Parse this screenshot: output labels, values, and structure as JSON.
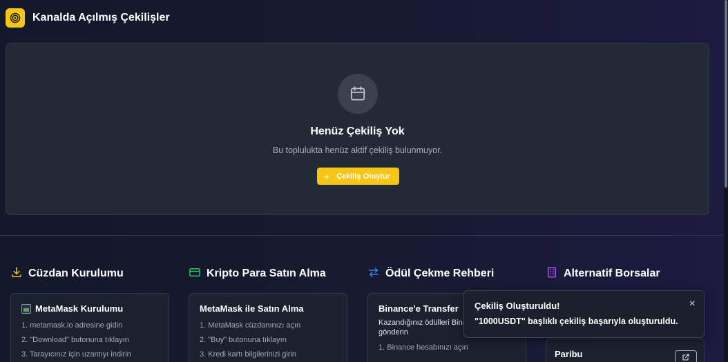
{
  "header": {
    "title": "Kanalda Açılmış Çekilişler",
    "logo_icon": "target-icon"
  },
  "empty_state": {
    "icon": "calendar-icon",
    "title": "Henüz Çekiliş Yok",
    "description": "Bu toplulukta henüz aktif çekiliş bulunmuyor.",
    "button_label": "Çekiliş Oluştur",
    "button_icon": "+"
  },
  "sections": [
    {
      "title": "Cüzdan Kurulumu",
      "icon": "download-icon",
      "icon_color": "#f5c518",
      "card": {
        "title": "MetaMask Kurulumu",
        "steps": [
          "1. metamask.io adresine gidin",
          "2. \"Download\" butonuna tıklayın",
          "3. Tarayıcınız için uzantıyı indirin"
        ]
      }
    },
    {
      "title": "Kripto Para Satın Alma",
      "icon": "credit-card-icon",
      "icon_color": "#22c55e",
      "card": {
        "title": "MetaMask ile Satın Alma",
        "steps": [
          "1. MetaMask cüzdanınızı açın",
          "2. \"Buy\" butonuna tıklayın",
          "3. Kredi kartı bilgilerinizi girin"
        ]
      }
    },
    {
      "title": "Ödül Çekme Rehberi",
      "icon": "transfer-icon",
      "icon_color": "#3b82f6",
      "card": {
        "title": "Binance'e Transfer",
        "subtitle": "Kazandığınız ödülleri Binance'e gönderin",
        "steps": [
          "1. Binance hesabınızı açın"
        ]
      }
    },
    {
      "title": "Alternatif Borsalar",
      "icon": "building-icon",
      "icon_color": "#a855f7",
      "card": {
        "title": "Paribu",
        "action_icon": "external-link-icon"
      }
    }
  ],
  "toast": {
    "title": "Çekiliş Oluşturuldu!",
    "message": "\"1000USDT\" başlıklı çekiliş başarıyla oluşturuldu.",
    "close_label": "×"
  },
  "colors": {
    "accent": "#f5c518",
    "card_bg": "#232a36",
    "page_bg": "#171a30"
  }
}
